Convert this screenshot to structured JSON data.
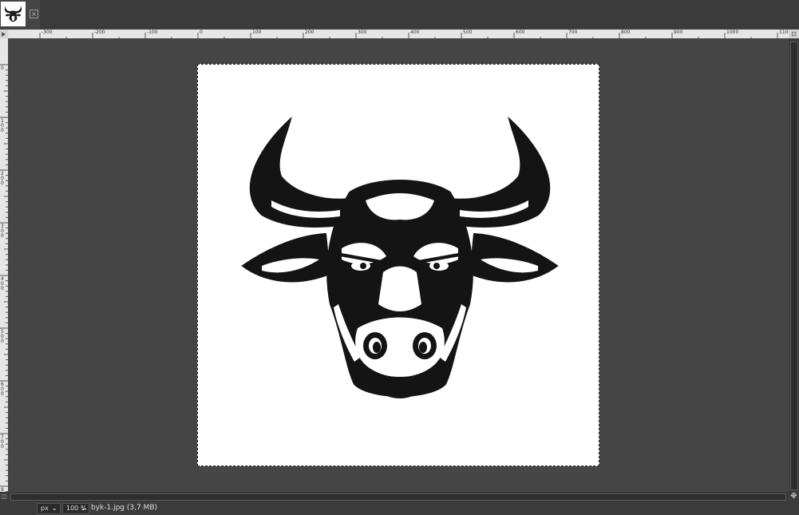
{
  "tabs": [
    {
      "label": "byk-1.jpg",
      "icon": "bull-thumbnail-icon"
    }
  ],
  "ruler": {
    "top_labels": [
      "-300",
      "-200",
      "-100",
      "0",
      "100",
      "200",
      "300",
      "400",
      "500",
      "600",
      "700",
      "800",
      "900",
      "1000",
      "1100"
    ],
    "left_labels": [
      "0",
      "100",
      "200",
      "300",
      "400",
      "500",
      "600",
      "700",
      "800"
    ]
  },
  "status": {
    "unit": "px",
    "zoom": "100 %",
    "file_info": "byk-1.jpg (3,7 MB)"
  }
}
